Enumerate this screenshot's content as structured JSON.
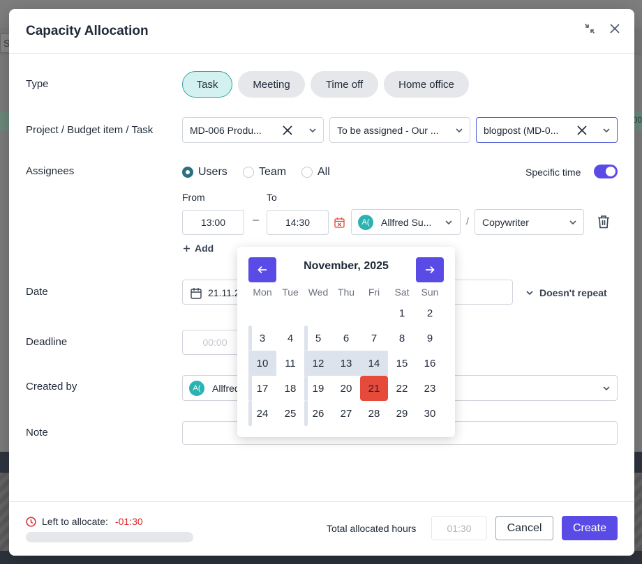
{
  "background": {
    "search_fragment": "S",
    "green_row_fragment": "00"
  },
  "modal": {
    "title": "Capacity Allocation",
    "type": {
      "label": "Type",
      "options": [
        "Task",
        "Meeting",
        "Time off",
        "Home office"
      ],
      "selected": "Task"
    },
    "project": {
      "label": "Project / Budget item / Task",
      "project_value": "MD-006 Produ...",
      "budget_value": "To be assigned - Our ...",
      "task_value": "blogpost (MD-0..."
    },
    "assignees": {
      "label": "Assignees",
      "options": [
        "Users",
        "Team",
        "All"
      ],
      "selected": "Users",
      "specific_time_label": "Specific time",
      "specific_time_on": true,
      "from_label": "From",
      "to_label": "To",
      "from_value": "13:00",
      "to_value": "14:30",
      "dash": "–",
      "user_initials": "A(",
      "user_value": "Allfred Su...",
      "slash": "/",
      "role_value": "Copywriter",
      "add_label": "Add"
    },
    "date": {
      "label": "Date",
      "value": "21.11.2",
      "repeat_label": "Doesn't repeat"
    },
    "deadline": {
      "label": "Deadline",
      "placeholder": "00:00"
    },
    "created_by": {
      "label": "Created by",
      "initials": "A(",
      "value": "Allfred"
    },
    "note": {
      "label": "Note"
    },
    "footer": {
      "left_label": "Left to allocate:",
      "left_value": "-01:30",
      "total_label": "Total allocated hours",
      "total_value": "01:30",
      "cancel": "Cancel",
      "create": "Create"
    }
  },
  "calendar": {
    "month": "November, 2025",
    "weekdays": [
      "Mon",
      "Tue",
      "Wed",
      "Thu",
      "Fri",
      "Sat",
      "Sun"
    ],
    "weeks": [
      [
        "",
        "",
        "",
        "",
        "",
        "1",
        "2"
      ],
      [
        "3",
        "4",
        "5",
        "6",
        "7",
        "8",
        "9"
      ],
      [
        "10",
        "11",
        "12",
        "13",
        "14",
        "15",
        "16"
      ],
      [
        "17",
        "18",
        "19",
        "20",
        "21",
        "22",
        "23"
      ],
      [
        "24",
        "25",
        "26",
        "27",
        "28",
        "29",
        "30"
      ]
    ],
    "selected_day": "21",
    "highlighted_days": [
      "10",
      "12",
      "13",
      "14"
    ]
  },
  "colors": {
    "accent": "#5b4be6",
    "teal": "#2bb3b3",
    "danger": "#dc2626",
    "selected_day": "#e64a3b"
  }
}
